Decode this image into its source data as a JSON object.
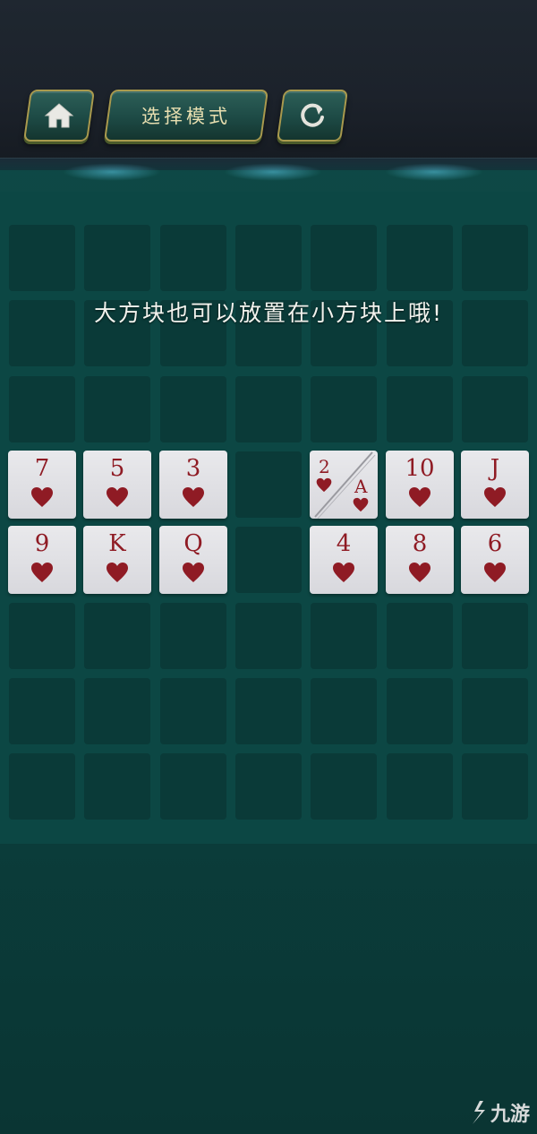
{
  "header": {
    "mode_button_label": "选择模式",
    "home_icon": "home-icon",
    "refresh_icon": "refresh-icon"
  },
  "hint_text": "大方块也可以放置在小方块上哦!",
  "board": {
    "rows": 8,
    "cols": 7,
    "cards": [
      {
        "row": 3,
        "col": 0,
        "rank": "7",
        "suit": "heart"
      },
      {
        "row": 3,
        "col": 1,
        "rank": "5",
        "suit": "heart"
      },
      {
        "row": 3,
        "col": 2,
        "rank": "3",
        "suit": "heart"
      },
      {
        "row": 3,
        "col": 4,
        "rank": "2",
        "rank2": "A",
        "suit": "heart",
        "split": true
      },
      {
        "row": 3,
        "col": 5,
        "rank": "10",
        "suit": "heart"
      },
      {
        "row": 3,
        "col": 6,
        "rank": "J",
        "suit": "heart"
      },
      {
        "row": 4,
        "col": 0,
        "rank": "9",
        "suit": "heart"
      },
      {
        "row": 4,
        "col": 1,
        "rank": "K",
        "suit": "heart"
      },
      {
        "row": 4,
        "col": 2,
        "rank": "Q",
        "suit": "heart"
      },
      {
        "row": 4,
        "col": 4,
        "rank": "4",
        "suit": "heart"
      },
      {
        "row": 4,
        "col": 5,
        "rank": "8",
        "suit": "heart"
      },
      {
        "row": 4,
        "col": 6,
        "rank": "6",
        "suit": "heart"
      }
    ]
  },
  "watermark": "九游",
  "colors": {
    "card_red": "#8f1b24",
    "button_border": "#a99a4e",
    "felt": "#0c4744"
  }
}
